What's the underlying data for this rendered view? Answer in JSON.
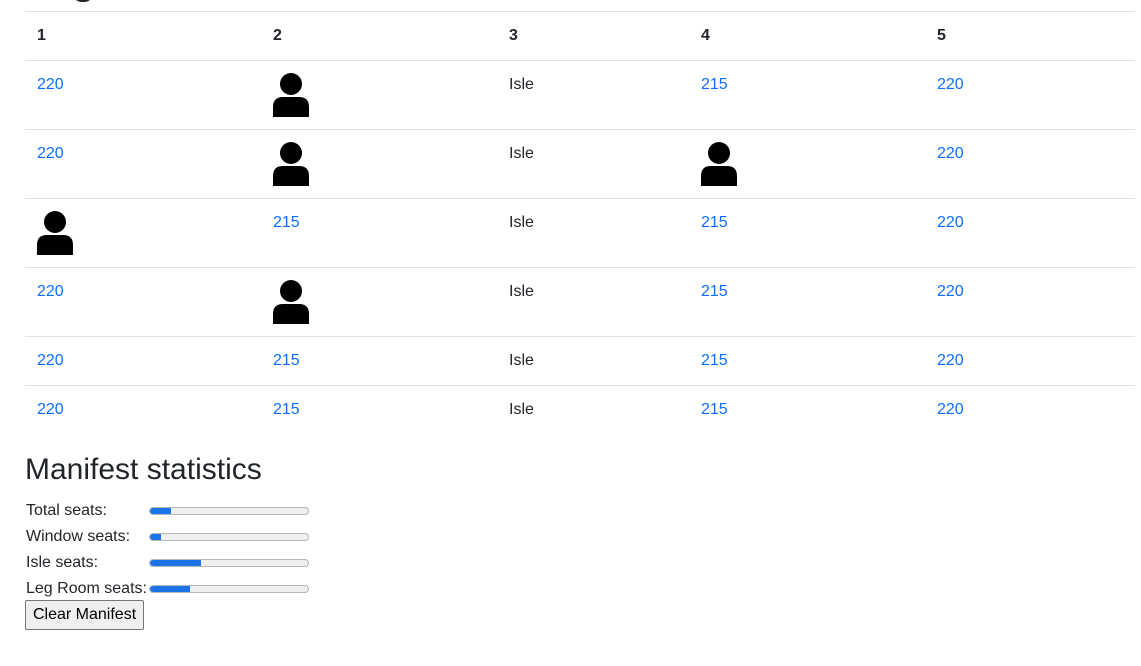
{
  "seat_map": {
    "columns": [
      "1",
      "2",
      "3",
      "4",
      "5"
    ],
    "rows": [
      [
        {
          "type": "price",
          "text": "220"
        },
        {
          "type": "occupied",
          "icon": "person-icon"
        },
        {
          "type": "isle",
          "text": "Isle"
        },
        {
          "type": "price",
          "text": "215"
        },
        {
          "type": "price",
          "text": "220"
        }
      ],
      [
        {
          "type": "price",
          "text": "220"
        },
        {
          "type": "occupied",
          "icon": "person-icon"
        },
        {
          "type": "isle",
          "text": "Isle"
        },
        {
          "type": "occupied",
          "icon": "person-icon"
        },
        {
          "type": "price",
          "text": "220"
        }
      ],
      [
        {
          "type": "occupied",
          "icon": "person-icon"
        },
        {
          "type": "price",
          "text": "215"
        },
        {
          "type": "isle",
          "text": "Isle"
        },
        {
          "type": "price",
          "text": "215"
        },
        {
          "type": "price",
          "text": "220"
        }
      ],
      [
        {
          "type": "price",
          "text": "220"
        },
        {
          "type": "occupied",
          "icon": "person-icon"
        },
        {
          "type": "isle",
          "text": "Isle"
        },
        {
          "type": "price",
          "text": "215"
        },
        {
          "type": "price",
          "text": "220"
        }
      ],
      [
        {
          "type": "price",
          "text": "220"
        },
        {
          "type": "price",
          "text": "215"
        },
        {
          "type": "isle",
          "text": "Isle"
        },
        {
          "type": "price",
          "text": "215"
        },
        {
          "type": "price",
          "text": "220"
        }
      ],
      [
        {
          "type": "price",
          "text": "220"
        },
        {
          "type": "price",
          "text": "215"
        },
        {
          "type": "isle",
          "text": "Isle"
        },
        {
          "type": "price",
          "text": "215"
        },
        {
          "type": "price",
          "text": "220"
        }
      ]
    ]
  },
  "stats": {
    "title": "Manifest statistics",
    "items": [
      {
        "key": "total",
        "label": "Total seats:",
        "progress": 0.13
      },
      {
        "key": "window",
        "label": "Window seats:",
        "progress": 0.07
      },
      {
        "key": "isle",
        "label": "Isle seats:",
        "progress": 0.32
      },
      {
        "key": "legroom",
        "label": "Leg Room seats:",
        "progress": 0.25
      }
    ]
  },
  "actions": {
    "clear_label": "Clear Manifest"
  },
  "colors": {
    "link": "#0d6efd",
    "progress_fill": "#1a73e8",
    "icon": "#000000"
  }
}
